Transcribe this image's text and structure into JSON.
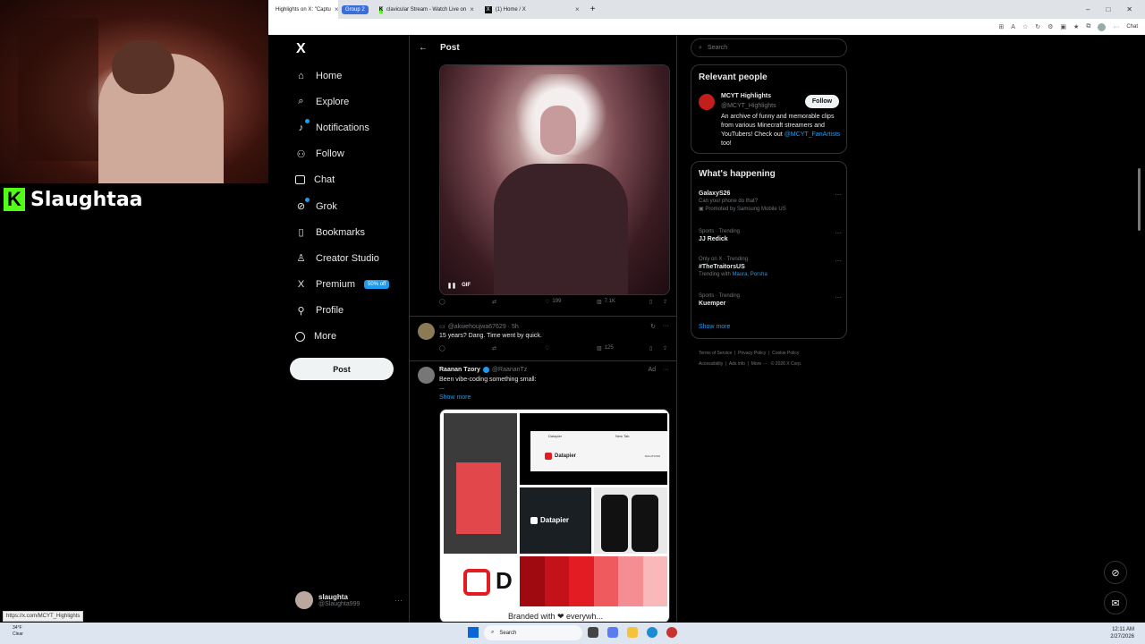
{
  "browser": {
    "tabs": [
      {
        "title": "Highlights on X: \"Captu",
        "active": true
      },
      {
        "title": "clavicular Stream - Watch Live on",
        "active": false
      },
      {
        "title": "(1) Home / X",
        "active": false
      }
    ],
    "group_label": "Group 2",
    "new_tab": "+",
    "copilot_label": "Chat"
  },
  "stream": {
    "streamer_name": "Slaughtaa",
    "platform_letter": "K"
  },
  "sidebar": {
    "logo": "X",
    "items": [
      {
        "label": "Home",
        "icon": "home-icon"
      },
      {
        "label": "Explore",
        "icon": "search-icon"
      },
      {
        "label": "Notifications",
        "icon": "bell-icon"
      },
      {
        "label": "Follow",
        "icon": "person-add-icon"
      },
      {
        "label": "Chat",
        "icon": "mail-icon"
      },
      {
        "label": "Grok",
        "icon": "grok-icon"
      },
      {
        "label": "Bookmarks",
        "icon": "bookmark-icon"
      },
      {
        "label": "Creator Studio",
        "icon": "creator-icon"
      },
      {
        "label": "Premium",
        "icon": "x-icon",
        "badge": "50% off"
      },
      {
        "label": "Profile",
        "icon": "person-icon"
      },
      {
        "label": "More",
        "icon": "more-circle-icon"
      }
    ],
    "post_button": "Post",
    "account": {
      "name": "slaughta",
      "handle": "@Slaughta999"
    }
  },
  "main": {
    "header_title": "Post",
    "gif": {
      "label": "GIF",
      "stats": {
        "retweets": "",
        "likes": "199",
        "views": "7.1K"
      }
    },
    "reply": {
      "handle": "@akwehoujwa67629 · 5h",
      "text": "15 years? Dang. Time went by quick.",
      "views": "125"
    },
    "ad": {
      "name": "Raanan Tzory",
      "handle": "@RaananTz",
      "ad_label": "Ad",
      "text": "Been vibe-coding something small:",
      "ellipsis": "...",
      "show_more": "Show more",
      "brand": "Datapier",
      "solutions": "SOLUTIONS",
      "new_tab": "New Tab",
      "bottom_text": "Branded with ❤ everywh..."
    }
  },
  "right": {
    "search_placeholder": "Search",
    "relevant": {
      "title": "Relevant people",
      "name": "MCYT Highlights",
      "handle": "@MCYT_Highlights",
      "follow": "Follow",
      "bio": "An archive of funny and memorable clips from various Minecraft streamers and YouTubers! Check out",
      "bio_link": "@MCYT_FanArtists",
      "bio_end": "too!"
    },
    "happening": {
      "title": "What's happening",
      "trends": [
        {
          "meta": "",
          "title": "GalaxyS26",
          "sub": "Can your phone do that?",
          "sub2": "Promoted by Samsung Mobile US"
        },
        {
          "meta": "Sports · Trending",
          "title": "JJ Redick",
          "sub": "",
          "sub2": ""
        },
        {
          "meta": "Only on X · Trending",
          "title": "#TheTraitorsUS",
          "sub": "Trending with",
          "sub2": "Maura, Porsha"
        },
        {
          "meta": "Sports · Trending",
          "title": "Kuemper",
          "sub": "",
          "sub2": ""
        }
      ],
      "show_more": "Show more"
    },
    "footer": [
      "Terms of Service",
      "Privacy Policy",
      "Cookie Policy",
      "Accessibility",
      "Ads info",
      "More ···",
      "© 2026 X Corp."
    ]
  },
  "status_url": "https://x.com/MCYT_Highlights",
  "taskbar": {
    "weather_temp": "34°F",
    "weather_desc": "Clear",
    "search": "Search",
    "time": "12:11 AM",
    "date": "2/27/2026"
  }
}
